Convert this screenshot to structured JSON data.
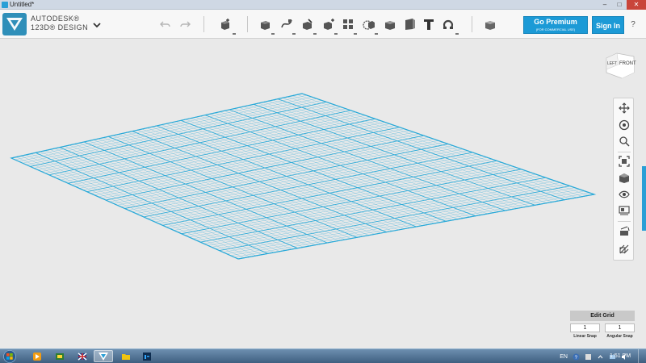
{
  "window": {
    "title": "Untitled*",
    "controls": {
      "minimize": "–",
      "maximize": "□",
      "close": "✕"
    }
  },
  "brand": {
    "line1": "AUTODESK®",
    "line2": "123D® DESIGN"
  },
  "toolbar": {
    "icons": [
      "undo-icon",
      "redo-icon",
      "primitives-icon",
      "sketch-icon",
      "construct-icon",
      "modify-icon",
      "pattern-icon",
      "grouping-icon",
      "combine-icon",
      "measure-icon",
      "text-icon",
      "snap-icon",
      "material-icon"
    ],
    "premium_label": "Go Premium",
    "premium_sub": "(FOR COMMERCIAL USE)",
    "signin_label": "Sign In",
    "help_label": "?"
  },
  "viewcube": {
    "left_label": "LEFT",
    "front_label": "FRONT"
  },
  "navbar": {
    "icons": [
      "pan-icon",
      "orbit-icon",
      "zoom-icon",
      "fit-icon",
      "view-cube-icon",
      "visibility-icon",
      "materials-outline-icon",
      "hide-sketch-icon",
      "hide-mesh-icon"
    ]
  },
  "edit_grid": {
    "button_label": "Edit Grid",
    "linear_snap_value": "1",
    "linear_snap_label": "Linear Snap",
    "angular_snap_value": "1",
    "angular_snap_label": "Angular Snap"
  },
  "taskbar": {
    "items": [
      "start-button",
      "media-player-icon",
      "game-icon",
      "flag-icon",
      "123d-design-icon",
      "file-explorer-icon",
      "photoshop-icon"
    ],
    "language": "EN",
    "time": "1:51 PM"
  },
  "colors": {
    "accent": "#1c9ad6",
    "grid": "#29a9d8",
    "background": "#e9e9e9"
  }
}
